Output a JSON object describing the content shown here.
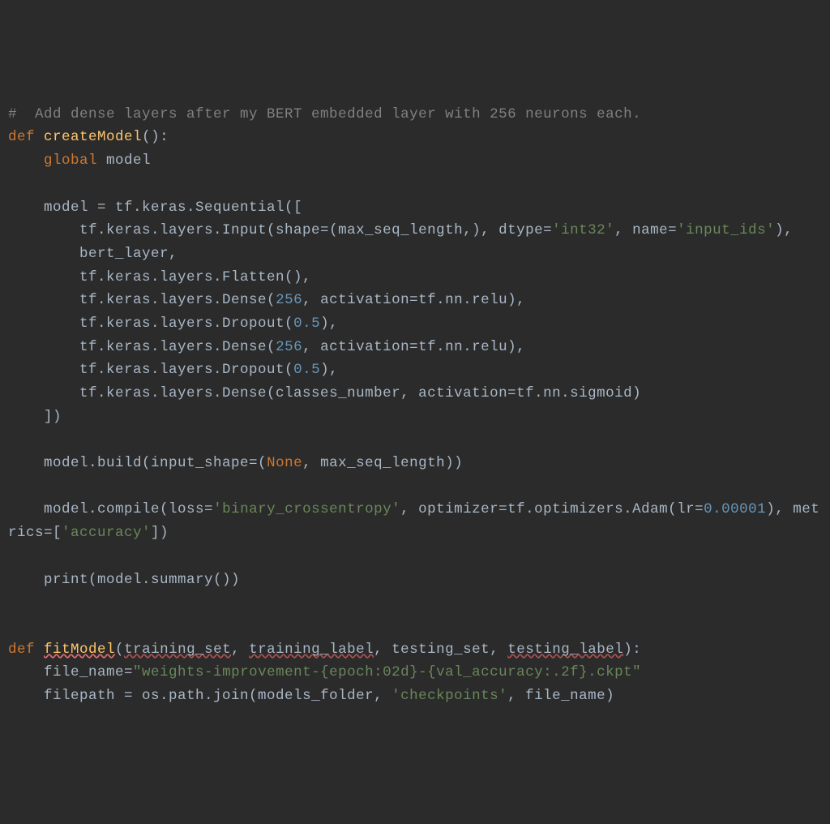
{
  "code": {
    "comment": "#  Add dense layers after my BERT embedded layer with 256 neurons each.",
    "def1": "def",
    "createModel": "createModel",
    "parens1": "():",
    "global": "global",
    "model": "model",
    "line_assign": "model = tf.keras.Sequential([",
    "input_prefix": "        tf.keras.layers.Input(shape=(max_seq_length,), dtype=",
    "int32": "'int32'",
    "name_eq": ", name=",
    "input_ids": "'input_ids'",
    "close_input": "),",
    "bert": "        bert_layer,",
    "flatten": "        tf.keras.layers.Flatten(),",
    "dense1a": "        tf.keras.layers.Dense(",
    "n256": "256",
    "dense1b": ", activation=tf.nn.relu),",
    "drop1a": "        tf.keras.layers.Dropout(",
    "p05": "0.5",
    "drop1b": "),",
    "dense3": "        tf.keras.layers.Dense(classes_number, activation=tf.nn.sigmoid)",
    "close_seq": "    ])",
    "build_a": "    model.build(input_shape=(",
    "none": "None",
    "build_b": ", max_seq_length))",
    "compile_a": "    model.compile(loss=",
    "bce": "'binary_crossentropy'",
    "compile_b": ", optimizer=tf.optimizers.Adam(lr=",
    "lr": "0.00001",
    "compile_c": "), metrics=[",
    "acc": "'accuracy'",
    "compile_d": "])",
    "print_sum": "    print(model.summary())",
    "def2": "def",
    "fitModel": "fitModel",
    "fit_open": "(",
    "train_set": "training_set",
    "comma_sp": ", ",
    "train_label": "training_label",
    "test_set": "testing_set",
    "test_label": "testing_label",
    "fit_close": "):",
    "filename_a": "    file_name=",
    "filename_str": "\"weights-improvement-{epoch:02d}-{val_accuracy:.2f}.ckpt\"",
    "filepath_a": "    filepath = os.path.join(models_folder, ",
    "checkpoints": "'checkpoints'",
    "filepath_b": ", file_name)"
  }
}
